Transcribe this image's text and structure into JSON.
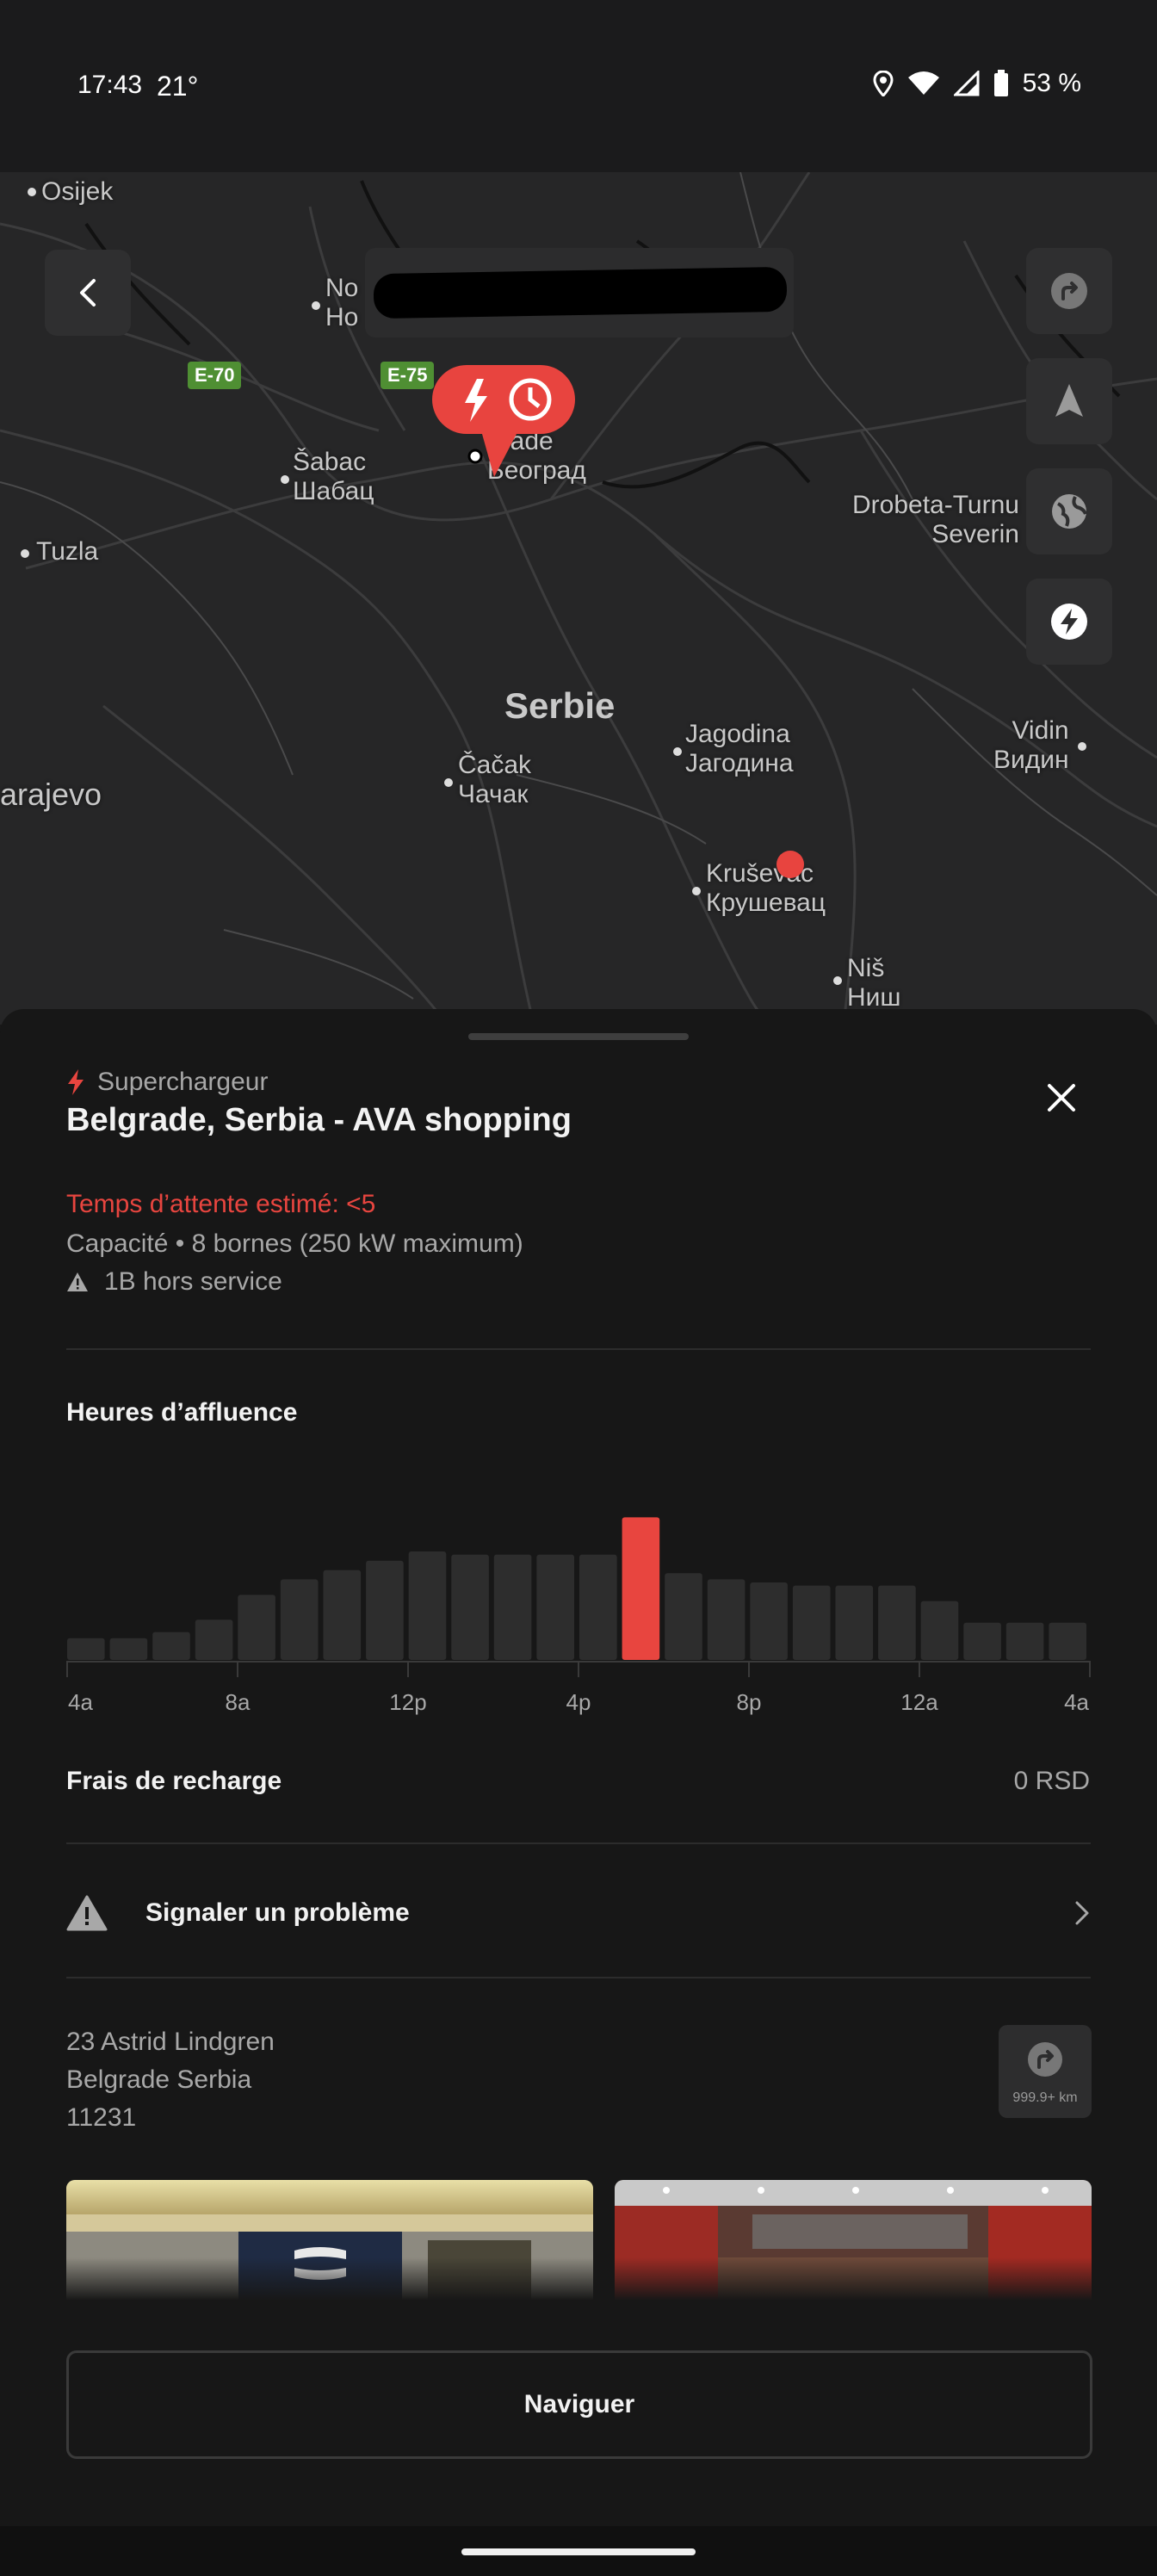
{
  "status_bar": {
    "time": "17:43",
    "temperature": "21°",
    "battery": "53 %",
    "icons": [
      "location-icon",
      "wifi-icon",
      "signal-icon",
      "battery-icon"
    ]
  },
  "map": {
    "cities": [
      {
        "name": "Osijek"
      },
      {
        "name": "No\nHo"
      },
      {
        "name": "Šabac\nШабац"
      },
      {
        "name": "Tuzla"
      },
      {
        "name": "grade\nБеоград"
      },
      {
        "name": "Drobeta-Turnu\nSeverin"
      },
      {
        "name": "Jagodina\nЈагодина"
      },
      {
        "name": "Čačak\nЧачак"
      },
      {
        "name": "Vidin\nВидин"
      },
      {
        "name": "arajevo"
      },
      {
        "name": "Kruševac\nКрушевац"
      },
      {
        "name": "Niš\nНиш"
      }
    ],
    "region": "Serbie",
    "road_shields": [
      "E-70",
      "E-75"
    ],
    "buttons": [
      "back-icon",
      "route-icon",
      "navigate-arrow-icon",
      "globe-icon",
      "lightning-icon"
    ]
  },
  "sheet": {
    "type_label": "Superchargeur",
    "title": "Belgrade, Serbia - AVA shopping",
    "wait_time": "Temps d’attente estimé: <5",
    "capacity": "Capacité • 8 bornes (250 kW maximum)",
    "out_of_service": "1B hors service",
    "busy_hours_title": "Heures d’affluence",
    "fee_label": "Frais de recharge",
    "fee_value": "0 RSD",
    "report_label": "Signaler un problème",
    "address_line1": "23 Astrid Lindgren",
    "address_line2": "Belgrade Serbia",
    "address_line3": "11231",
    "direction_distance": "999.9+ km",
    "navigate_label": "Naviguer",
    "accent_color": "#e8453f"
  },
  "chart_data": {
    "type": "bar",
    "title": "Heures d’affluence",
    "tick_labels": [
      "4a",
      "8a",
      "12p",
      "4p",
      "8p",
      "12a",
      "4a"
    ],
    "values": [
      14,
      14,
      18,
      26,
      42,
      52,
      58,
      64,
      70,
      68,
      68,
      68,
      68,
      92,
      56,
      52,
      50,
      48,
      48,
      48,
      38,
      24,
      24,
      24
    ],
    "highlight_index": 13,
    "ylim": [
      0,
      100
    ]
  }
}
